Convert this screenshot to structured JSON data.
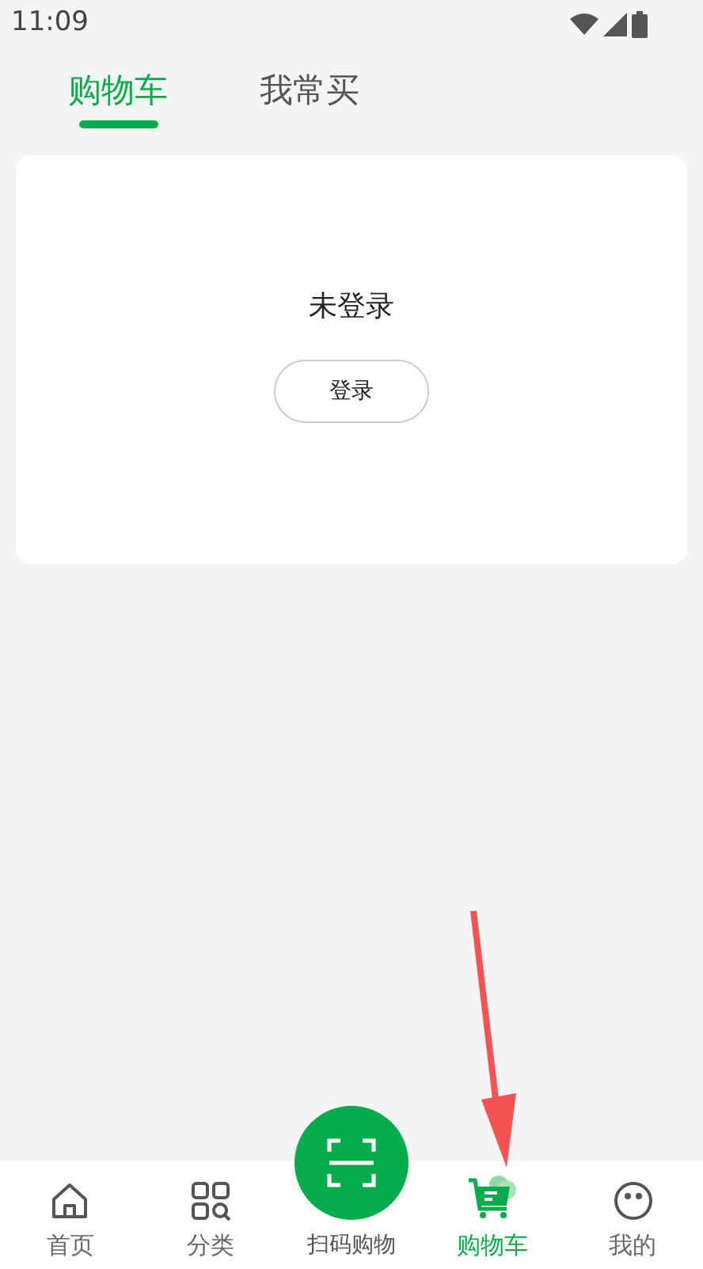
{
  "status_bar": {
    "time": "11:09"
  },
  "tabs": [
    {
      "label": "购物车",
      "selected": true
    },
    {
      "label": "我常买",
      "selected": false
    }
  ],
  "card": {
    "message": "未登录",
    "button": "登录"
  },
  "bottom_nav": [
    {
      "label": "首页",
      "kind": "home",
      "selected": false
    },
    {
      "label": "分类",
      "kind": "category",
      "selected": false
    },
    {
      "label": "扫码购物",
      "kind": "scan",
      "selected": false
    },
    {
      "label": "购物车",
      "kind": "cart",
      "selected": true
    },
    {
      "label": "我的",
      "kind": "profile",
      "selected": false
    }
  ]
}
